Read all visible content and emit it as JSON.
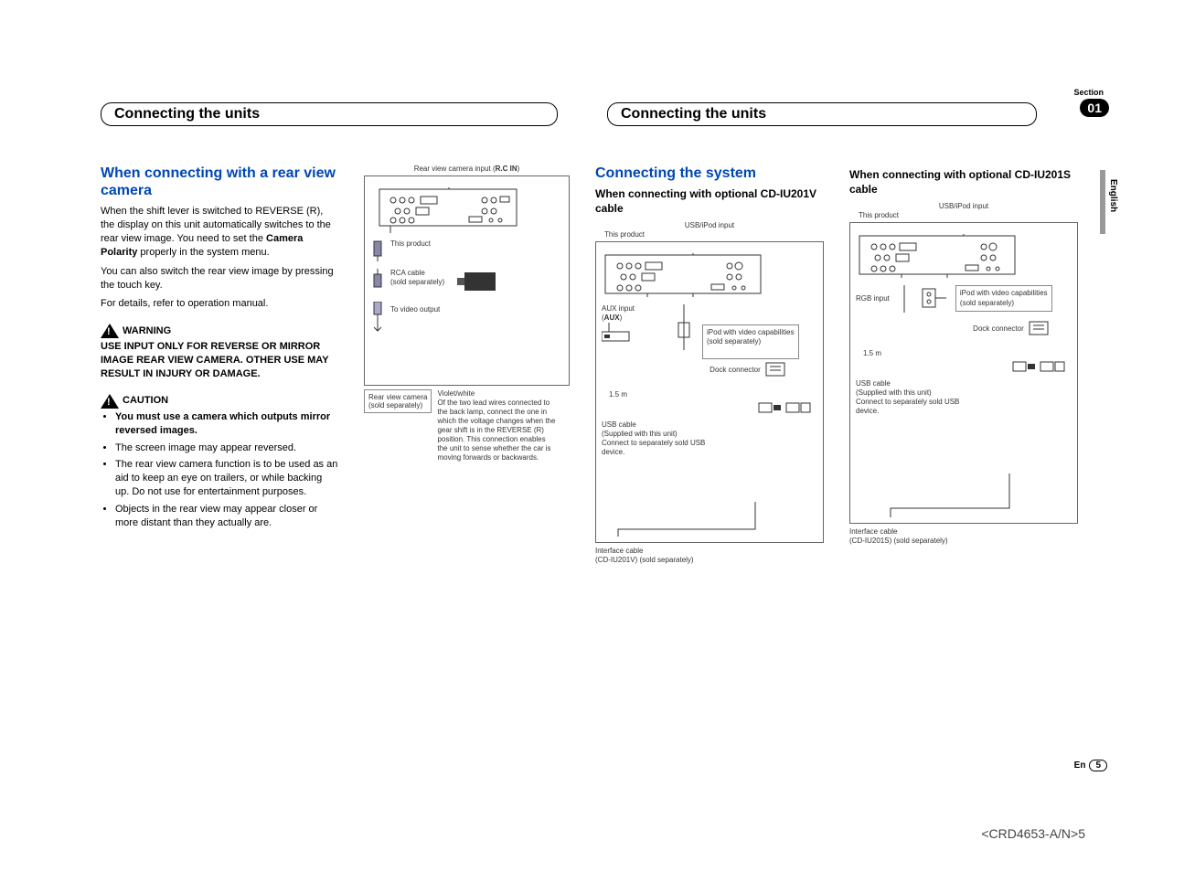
{
  "section": {
    "label": "Section",
    "number": "01"
  },
  "headers": {
    "left": "Connecting the units",
    "right": "Connecting the units"
  },
  "language": "English",
  "col1": {
    "title": "When connecting with a rear view camera",
    "p1_a": "When the shift lever is switched to REVERSE (R), the display on this unit automatically switches to the rear view image. You need to set the ",
    "p1_bold": "Camera Polarity",
    "p1_b": " properly in the system menu.",
    "p2": "You can also switch the rear view image by pressing the touch key.",
    "p3": "For details, refer to operation manual.",
    "warning_label": "WARNING",
    "warning_body": "USE INPUT ONLY FOR REVERSE OR MIRROR IMAGE REAR VIEW CAMERA. OTHER USE MAY RESULT IN INJURY OR DAMAGE.",
    "caution_label": "CAUTION",
    "caution_items": [
      "You must use a camera which outputs mirror reversed images.",
      "The screen image may appear reversed.",
      "The rear view camera function is to be used as an aid to keep an eye on trailers, or while backing up. Do not use for entertainment purposes.",
      "Objects in the rear view may appear closer or more distant than they actually are."
    ]
  },
  "col2": {
    "top_label_a": "Rear view camera input (",
    "top_label_bold": "R.C IN",
    "top_label_b": ")",
    "this_product": "This product",
    "rca_a": "RCA cable",
    "rca_b": "(sold separately)",
    "to_video": "To video output",
    "rvc_a": "Rear view camera",
    "rvc_b": "(sold separately)",
    "violet_title": "Violet/white",
    "violet_body": "Of the two lead wires connected to the back lamp, connect the one in which the voltage changes when the gear shift is in the REVERSE (R) position. This connection enables the unit to sense whether the car is moving forwards or backwards."
  },
  "col3": {
    "title": "Connecting the system",
    "subtitle": "When connecting with optional CD-IU201V cable",
    "usb_ipod": "USB/iPod input",
    "this_product": "This product",
    "aux_a": "AUX input",
    "aux_b": "(",
    "aux_bold": "AUX",
    "aux_c": ")",
    "ipod_a": "iPod with video capabilities",
    "ipod_b": "(sold separately)",
    "dock": "Dock connector",
    "len": "1.5 m",
    "usb_a": "USB cable",
    "usb_b": "(Supplied with this unit)",
    "usb_c": "Connect to separately sold USB device.",
    "iface_a": "Interface cable",
    "iface_b": "(CD-IU201V) (sold separately)"
  },
  "col4": {
    "subtitle": "When connecting with optional CD-IU201S cable",
    "usb_ipod": "USB/iPod input",
    "this_product": "This product",
    "rgb": "RGB input",
    "ipod_a": "iPod with video capabilities",
    "ipod_b": "(sold separately)",
    "dock": "Dock connector",
    "len": "1.5 m",
    "usb_a": "USB cable",
    "usb_b": "(Supplied with this unit)",
    "usb_c": "Connect to separately sold USB device.",
    "iface_a": "Interface cable",
    "iface_b": "(CD-IU201S) (sold separately)"
  },
  "footer": {
    "ref": "<CRD4653-A/N>5",
    "lang_code": "En",
    "page": "5"
  }
}
